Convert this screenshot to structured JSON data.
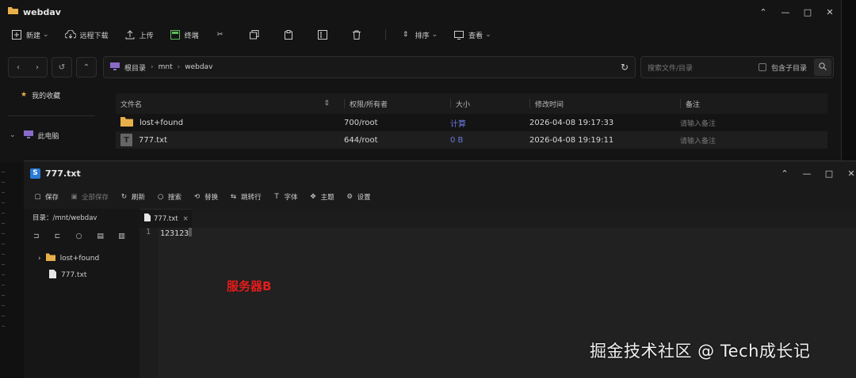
{
  "fm": {
    "title": "webdav",
    "toolbar": {
      "new": "新建",
      "remote_download": "远程下载",
      "upload": "上传",
      "terminal": "终端",
      "sort": "排序",
      "view": "查看"
    },
    "path": [
      "根目录",
      "mnt",
      "webdav"
    ],
    "search": {
      "placeholder": "搜索文件/目录",
      "include_sub": "包含子目录"
    },
    "sidebar": {
      "favorites": "我的收藏",
      "this_pc": "此电脑"
    },
    "columns": {
      "name": "文件名",
      "perm": "权限/所有者",
      "size": "大小",
      "mtime": "修改时间",
      "note": "备注"
    },
    "rows": [
      {
        "name": "lost+found",
        "perm": "700/root",
        "size": "计算",
        "mtime": "2026-04-08 19:17:33",
        "note": "请输入备注"
      },
      {
        "name": "777.txt",
        "perm": "644/root",
        "size": "0 B",
        "mtime": "2026-04-08 19:19:11",
        "note": "请输入备注"
      }
    ]
  },
  "editor": {
    "title": "777.txt",
    "toolbar": {
      "save": "保存",
      "save_all": "全部保存",
      "refresh": "刷新",
      "search": "搜索",
      "replace": "替换",
      "goto_line": "跳转行",
      "font": "字体",
      "theme": "主题",
      "settings": "设置"
    },
    "dir_label": "目录：/mnt/webdav",
    "tree": [
      {
        "name": "lost+found"
      },
      {
        "name": "777.txt"
      }
    ],
    "tab": "777.txt",
    "line_number": "1",
    "content": "123123"
  },
  "annotation": "服务器B",
  "watermark": "掘金技术社区 @ Tech成长记",
  "colors": {
    "link": "#6b79e0",
    "folder": "#e8b04a",
    "annotation": "#e51c1c",
    "logo": "#2a7bd8"
  }
}
